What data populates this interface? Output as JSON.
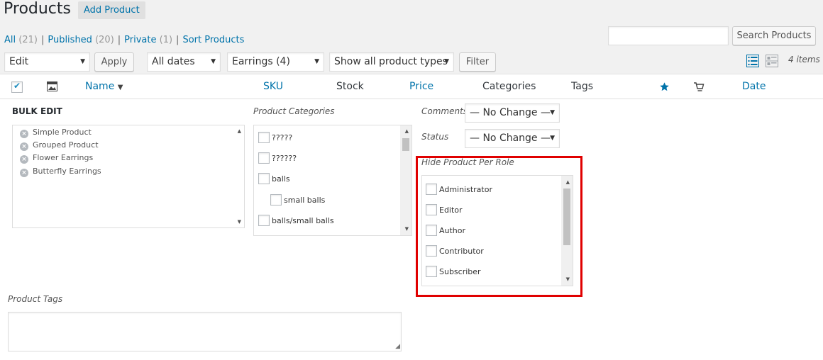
{
  "page": {
    "title": "Products",
    "add_button": "Add Product"
  },
  "views": [
    {
      "label": "All",
      "count": "(21)"
    },
    {
      "label": "Published",
      "count": "(20)"
    },
    {
      "label": "Private",
      "count": "(1)"
    },
    {
      "label": "Sort Products",
      "count": ""
    }
  ],
  "search": {
    "button": "Search Products",
    "value": ""
  },
  "toolbar": {
    "bulk_action": "Edit",
    "apply": "Apply",
    "dates": "All dates",
    "category": "Earrings (4)",
    "product_type": "Show all product types",
    "filter": "Filter",
    "items_count": "4 items"
  },
  "columns": {
    "name": "Name",
    "sku": "SKU",
    "stock": "Stock",
    "price": "Price",
    "categories": "Categories",
    "tags": "Tags",
    "date": "Date",
    "sort_indicator": "▼"
  },
  "bulk_edit": {
    "title": "BULK EDIT",
    "items": [
      "Simple Product",
      "Grouped Product",
      "Flower Earrings",
      "Butterfly Earrings"
    ]
  },
  "product_categories": {
    "label": "Product Categories",
    "items": [
      "?????",
      "??????",
      "balls",
      "small balls",
      "balls/small balls"
    ]
  },
  "comments": {
    "label": "Comments",
    "value": "— No Change —"
  },
  "status": {
    "label": "Status",
    "value": "— No Change —"
  },
  "hide_per_role": {
    "label": "Hide Product Per Role",
    "roles": [
      "Administrator",
      "Editor",
      "Author",
      "Contributor",
      "Subscriber"
    ]
  },
  "product_tags": {
    "label": "Product Tags",
    "value": ""
  },
  "colors": {
    "link": "#0073aa",
    "highlight": "#e00000",
    "star": "#0073aa"
  }
}
